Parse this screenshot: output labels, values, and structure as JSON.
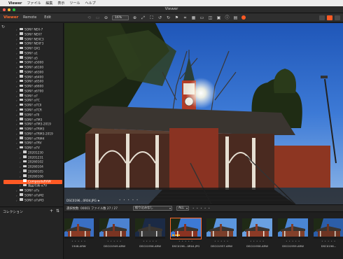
{
  "menubar": {
    "apple": "",
    "app_name": "Viewer",
    "items": [
      "ファイル",
      "編集",
      "表示",
      "ツール",
      "ヘルプ"
    ]
  },
  "window": {
    "title": "Viewer"
  },
  "toolbar": {
    "brand": "Viewer",
    "tabs": [
      "Remote",
      "Edit"
    ],
    "zoom_value": "16%",
    "accent_color": "#ff5a24"
  },
  "sidebar": {
    "tree": [
      {
        "label": "SONY NEX-7",
        "level": 0
      },
      {
        "label": "SONY NEX7",
        "level": 0
      },
      {
        "label": "SONY NEXC3",
        "level": 0
      },
      {
        "label": "SONY NEXF3",
        "level": 0
      },
      {
        "label": "SONY QX1",
        "level": 0
      },
      {
        "label": "SONY α1",
        "level": 0
      },
      {
        "label": "SONY α5",
        "level": 0
      },
      {
        "label": "SONY α5000",
        "level": 0
      },
      {
        "label": "SONY α6100",
        "level": 0
      },
      {
        "label": "SONY α6300",
        "level": 0
      },
      {
        "label": "SONY α6400",
        "level": 0
      },
      {
        "label": "SONY α6500",
        "level": 0
      },
      {
        "label": "SONY α6600",
        "level": 0
      },
      {
        "label": "SONY α6700",
        "level": 0
      },
      {
        "label": "SONY α7",
        "level": 0
      },
      {
        "label": "SONY α7C",
        "level": 0
      },
      {
        "label": "SONY α7CII",
        "level": 0
      },
      {
        "label": "SONY α7CR",
        "level": 0
      },
      {
        "label": "SONY α7II",
        "level": 0
      },
      {
        "label": "SONY α7M3",
        "level": 0
      },
      {
        "label": "SONY α7M3-2019",
        "level": 0
      },
      {
        "label": "SONY α7RM3",
        "level": 0
      },
      {
        "label": "SONY α7RM3-2019",
        "level": 0
      },
      {
        "label": "SONY α7RM4",
        "level": 0
      },
      {
        "label": "SONY α7RV",
        "level": 0
      },
      {
        "label": "SONY α7V",
        "level": 0,
        "expanded": true
      },
      {
        "label": "20201230",
        "level": 1
      },
      {
        "label": "20201231",
        "level": 1
      },
      {
        "label": "20260102",
        "level": 1
      },
      {
        "label": "20260104",
        "level": 1
      },
      {
        "label": "20260105",
        "level": 1
      },
      {
        "label": "20260106",
        "level": 1
      },
      {
        "label": "CompositeRAW",
        "level": 1,
        "selected": true
      },
      {
        "label": "製品写真-α7V",
        "level": 1
      },
      {
        "label": "SONY α7s",
        "level": 0
      },
      {
        "label": "SONY α7sM2",
        "level": 0
      },
      {
        "label": "SONY α7sM3",
        "level": 0
      }
    ]
  },
  "collection": {
    "label": "コレクション",
    "add": "+",
    "sort": "⇅"
  },
  "viewer": {
    "caption": "DSC0196...0R04.JPG ★",
    "rating_dots": "• • • • •"
  },
  "infobar": {
    "summary": "選択枚数: 00001  ファイル数 27 / 27",
    "filter": "絞り込みなし",
    "rating": "ALL",
    "stars": "• • • • •"
  },
  "thumbnails": [
    {
      "name": "1948.ARW",
      "dots": "• • • • •",
      "labels": false,
      "selected": false
    },
    {
      "name": "DSC01949.ARW",
      "dots": "• • • • •",
      "labels": false,
      "selected": false
    },
    {
      "name": "DSC01956.ARW",
      "dots": "• • • • •",
      "labels": false,
      "selected": false
    },
    {
      "name": "DSC0196...0R04.JPG",
      "dots": "• • • • •",
      "labels": true,
      "selected": true
    },
    {
      "name": "DSC01957.ARW",
      "dots": "• • • • •",
      "labels": false,
      "selected": false
    },
    {
      "name": "DSC01958.ARW",
      "dots": "• • • • •",
      "labels": false,
      "selected": false
    },
    {
      "name": "DSC01959.ARW",
      "dots": "• • • • •",
      "labels": false,
      "selected": false
    },
    {
      "name": "DSC0196...",
      "dots": "• • • • •",
      "labels": false,
      "selected": false
    }
  ]
}
